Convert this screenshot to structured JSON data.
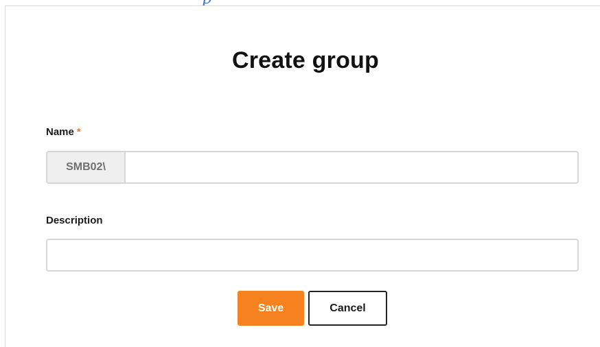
{
  "dialog": {
    "title": "Create group",
    "name_field": {
      "label": "Name",
      "required_marker": "*",
      "prefix": "SMB02\\",
      "value": "",
      "placeholder": ""
    },
    "description_field": {
      "label": "Description",
      "value": "",
      "placeholder": ""
    },
    "buttons": {
      "save_label": "Save",
      "cancel_label": "Cancel"
    }
  },
  "colors": {
    "accent": "#f5821f",
    "required": "#f07a1a",
    "prefix_bg": "#efefef",
    "border": "#d6d6d6"
  }
}
